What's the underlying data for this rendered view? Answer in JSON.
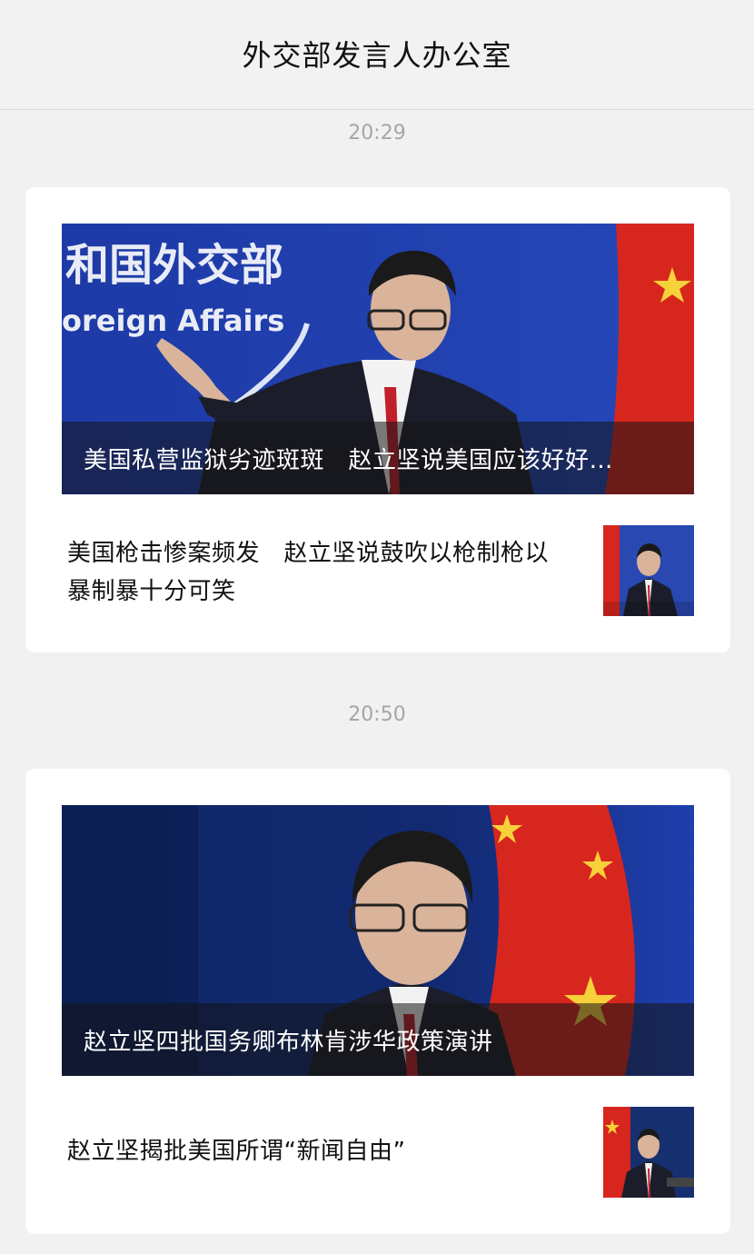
{
  "header": {
    "title": "外交部发言人办公室"
  },
  "feed": [
    {
      "time": "20:29",
      "hero": {
        "caption": "美国私营监狱劣迹斑斑　赵立坚说美国应该好好…",
        "backdrop_text_cn": "和国外交部",
        "backdrop_text_en": "oreign Affairs"
      },
      "secondary": {
        "title": "美国枪击惨案频发　赵立坚说鼓吹以枪制枪以暴制暴十分可笑"
      }
    },
    {
      "time": "20:50",
      "hero": {
        "caption": "赵立坚四批国务卿布林肯涉华政策演讲"
      },
      "secondary": {
        "title": "赵立坚揭批美国所谓“新闻自由”"
      }
    }
  ],
  "colors": {
    "backdrop_blue": "#1f3fae",
    "flag_red": "#d7261e",
    "flag_star": "#f7d13a"
  }
}
